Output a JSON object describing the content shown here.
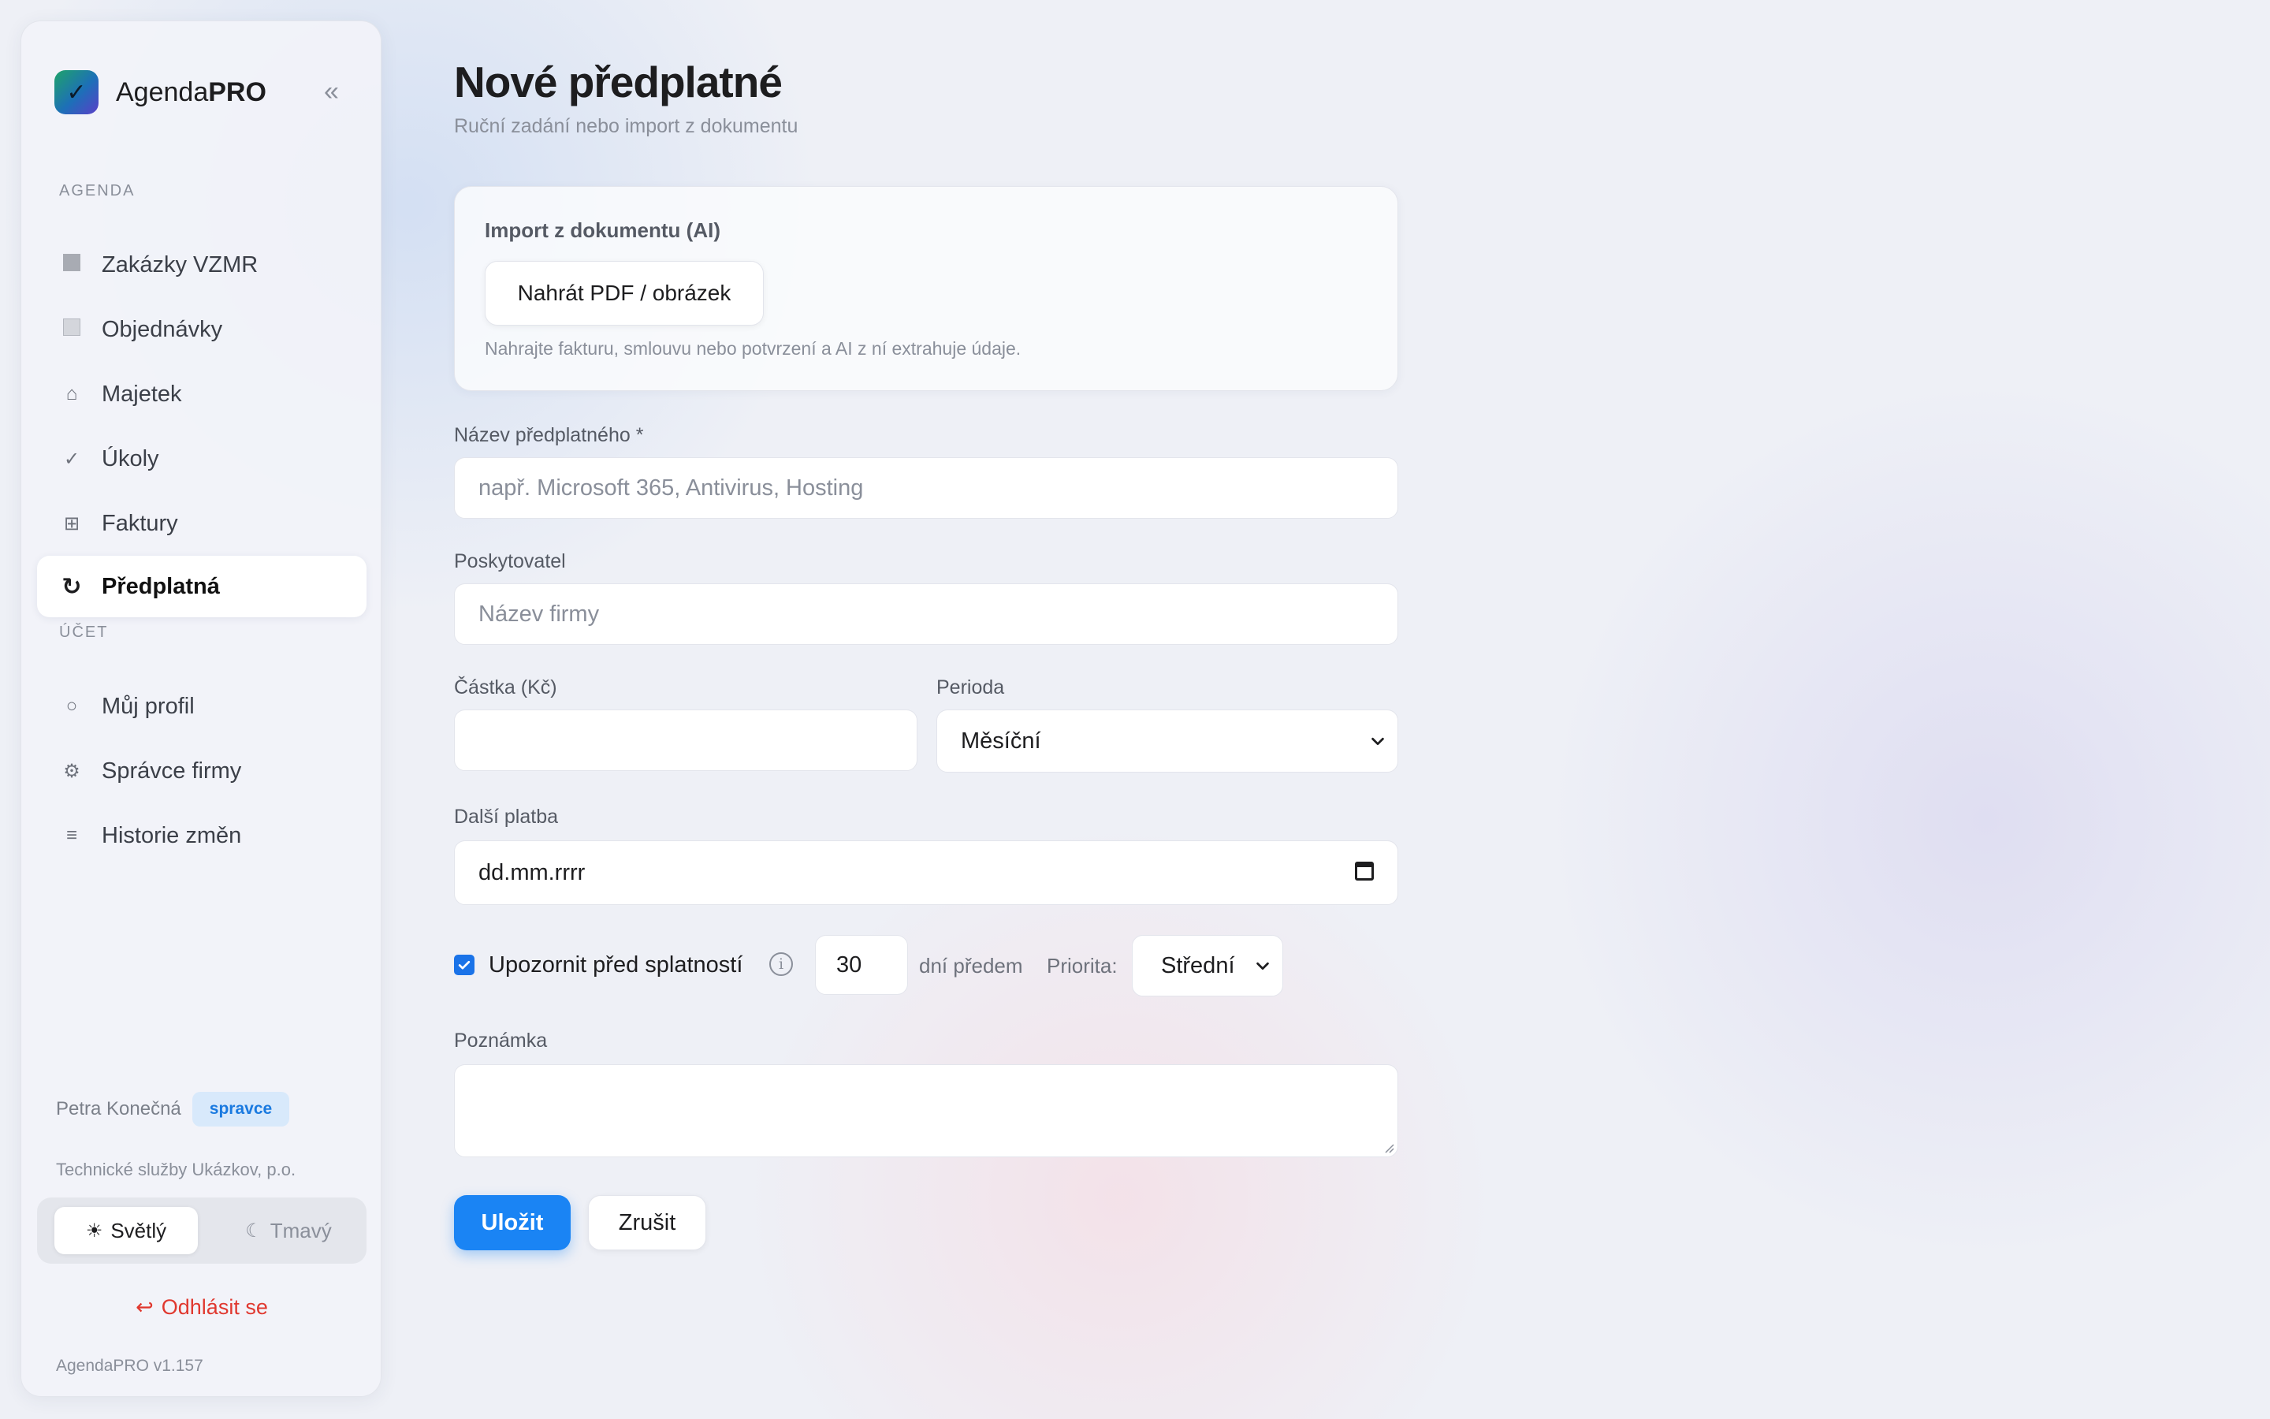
{
  "app": {
    "name_regular": "Agenda",
    "name_bold": "PRO",
    "version": "AgendaPRO v1.157"
  },
  "sidebar": {
    "section_agenda": "AGENDA",
    "section_account": "ÚČET",
    "agenda_items": [
      {
        "label": "Zakázky VZMR",
        "icon": "square-icon"
      },
      {
        "label": "Objednávky",
        "icon": "square-outline-icon"
      },
      {
        "label": "Majetek",
        "icon": "house-icon"
      },
      {
        "label": "Úkoly",
        "icon": "check-icon"
      },
      {
        "label": "Faktury",
        "icon": "grid-icon"
      },
      {
        "label": "Předplatná",
        "icon": "refresh-icon",
        "active": true
      }
    ],
    "account_items": [
      {
        "label": "Můj profil",
        "icon": "circle-icon"
      },
      {
        "label": "Správce firmy",
        "icon": "gear-icon"
      },
      {
        "label": "Historie změn",
        "icon": "list-icon"
      }
    ],
    "user": {
      "name": "Petra Konečná",
      "role": "spravce",
      "organization": "Technické služby Ukázkov, p.o."
    },
    "theme": {
      "light_label": "Světlý",
      "dark_label": "Tmavý",
      "selected": "light"
    },
    "logout_label": "Odhlásit se"
  },
  "page": {
    "title": "Nové předplatné",
    "subtitle": "Ruční zadání nebo import z dokumentu"
  },
  "import": {
    "title": "Import z dokumentu (AI)",
    "upload_label": "Nahrát PDF / obrázek",
    "hint": "Nahrajte fakturu, smlouvu nebo potvrzení a AI z ní extrahuje údaje."
  },
  "form": {
    "name": {
      "label": "Název předplatného *",
      "placeholder": "např. Microsoft 365, Antivirus, Hosting",
      "value": ""
    },
    "provider": {
      "label": "Poskytovatel",
      "placeholder": "Název firmy",
      "value": ""
    },
    "amount": {
      "label": "Částka (Kč)",
      "value": ""
    },
    "period": {
      "label": "Perioda",
      "value": "Měsíční"
    },
    "next_payment": {
      "label": "Další platba",
      "value": "dd.mm.rrrr"
    },
    "reminder": {
      "label": "Upozornit před splatností",
      "checked": true,
      "days": "30",
      "days_suffix": "dní předem",
      "priority_label": "Priorita:",
      "priority_value": "Střední"
    },
    "note": {
      "label": "Poznámka",
      "value": ""
    },
    "save_label": "Uložit",
    "cancel_label": "Zrušit"
  },
  "colors": {
    "accent": "#1a84f4",
    "danger": "#e0382f",
    "badge_bg": "#d8e9fb",
    "badge_text": "#1a7ae0"
  }
}
